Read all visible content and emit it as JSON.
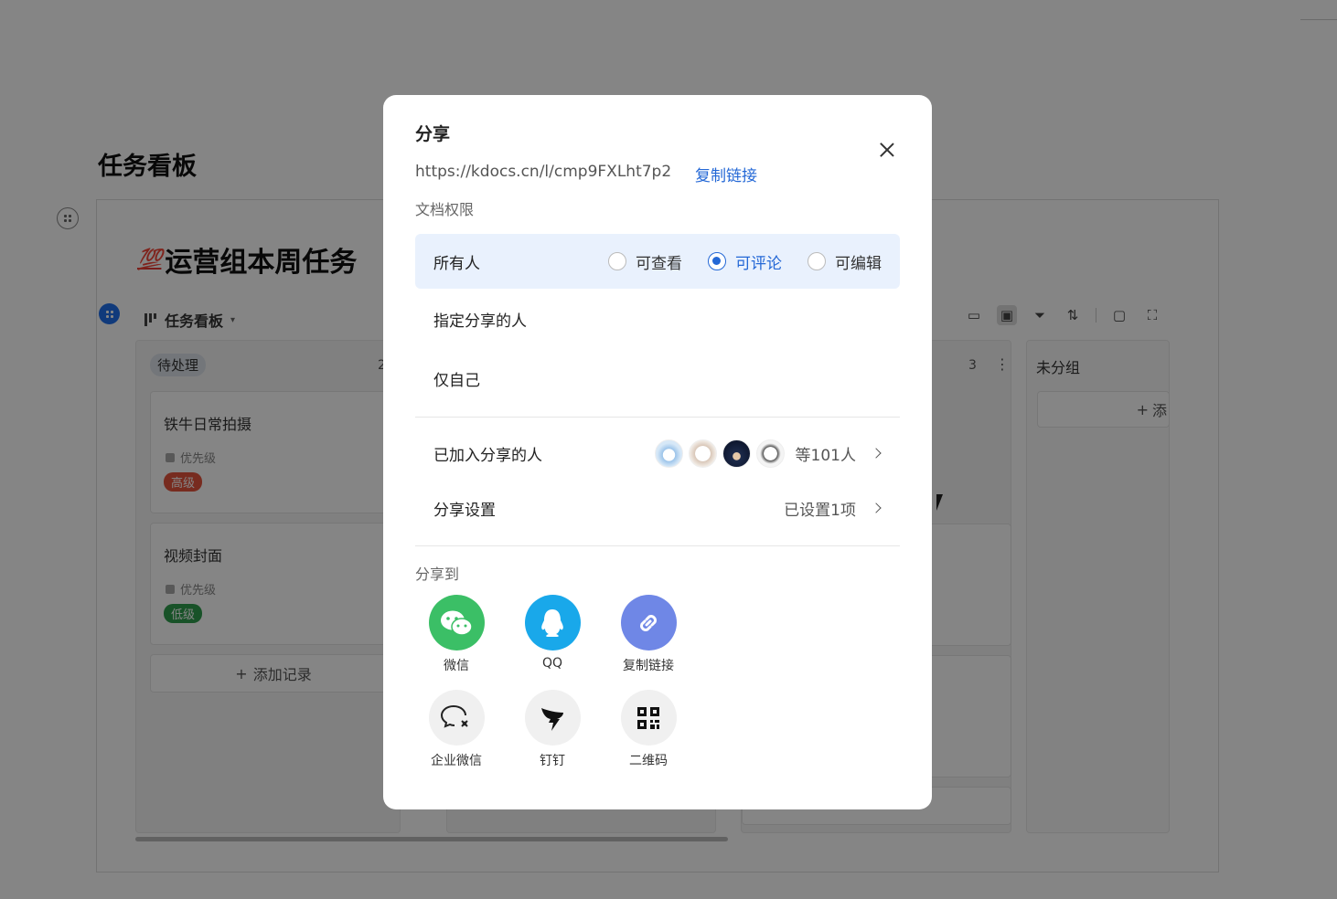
{
  "background": {
    "page_title": "任务看板",
    "board_heading": "运营组本周任务",
    "board_emoji": "💯",
    "view": {
      "name": "任务看板",
      "caret": "▾"
    },
    "columns": [
      {
        "tag": "待处理",
        "count": "2",
        "cards": [
          {
            "title": "铁牛日常拍摄",
            "field": "优先级",
            "badge": "高级"
          },
          {
            "title": "视频封面",
            "field": "优先级",
            "badge": "低级"
          }
        ],
        "add_record": "添加记录"
      },
      {
        "tag": "",
        "count": "3"
      },
      {
        "tag": "未分组",
        "add_record": "添"
      }
    ]
  },
  "share_dialog": {
    "title": "分享",
    "link_url": "https://kdocs.cn/l/cmp9FXLht7p2",
    "copy_link": "复制链接",
    "permission_label": "文档权限",
    "scopes": {
      "everyone": "所有人",
      "specified": "指定分享的人",
      "self": "仅自己"
    },
    "radios": {
      "view": "可查看",
      "comment": "可评论",
      "edit": "可编辑"
    },
    "selected_radio": "可评论",
    "joined": {
      "label": "已加入分享的人",
      "count_text": "等101人"
    },
    "settings": {
      "label": "分享设置",
      "value": "已设置1项"
    },
    "share_to_label": "分享到",
    "targets": {
      "wechat": "微信",
      "qq": "QQ",
      "copy_link": "复制链接",
      "wecom": "企业微信",
      "dingtalk": "钉钉",
      "qrcode": "二维码"
    }
  },
  "colors": {
    "accent": "#2468d6",
    "selected_bg": "#e9f1fd",
    "wechat": "#3bbf66",
    "qq": "#19a8ea",
    "copy_link": "#6f87e6",
    "badge_high": "#e5533c",
    "badge_low": "#2e9e4d"
  },
  "icons": {
    "close": "close-icon",
    "chevron": "chevron-right-icon",
    "wechat": "wechat-icon",
    "qq": "qq-penguin-icon",
    "link": "link-icon",
    "wecom": "wecom-icon",
    "dingtalk": "dingtalk-icon",
    "qrcode": "qrcode-icon"
  }
}
